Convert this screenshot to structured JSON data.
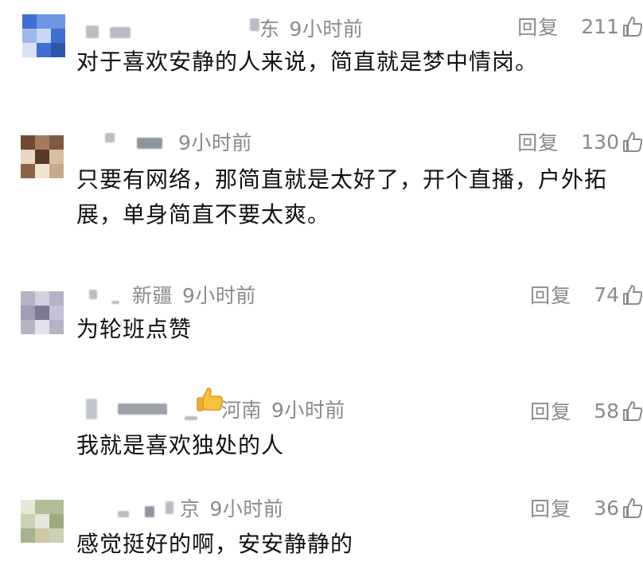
{
  "comments": [
    {
      "location": "东",
      "time": "9小时前",
      "reply": "回复",
      "likes": "211",
      "text": "对于喜欢安静的人来说，简直就是梦中情岗。"
    },
    {
      "location": "",
      "time": "9小时前",
      "reply": "回复",
      "likes": "130",
      "text": "只要有网络，那简直就是太好了，开个直播，户外拓展，单身简直不要太爽。"
    },
    {
      "location": "新疆",
      "time": "9小时前",
      "reply": "回复",
      "likes": "74",
      "text": "为轮班点赞"
    },
    {
      "location": "河南",
      "time": "9小时前",
      "reply": "回复",
      "likes": "58",
      "text": "我就是喜欢独处的人"
    },
    {
      "location": "京",
      "time": "9小时前",
      "reply": "回复",
      "likes": "36",
      "text": "感觉挺好的啊，安安静静的"
    }
  ],
  "icons": {
    "like": "thumbs-up-outline-icon",
    "emoji": "thumbs-up-emoji-icon"
  }
}
